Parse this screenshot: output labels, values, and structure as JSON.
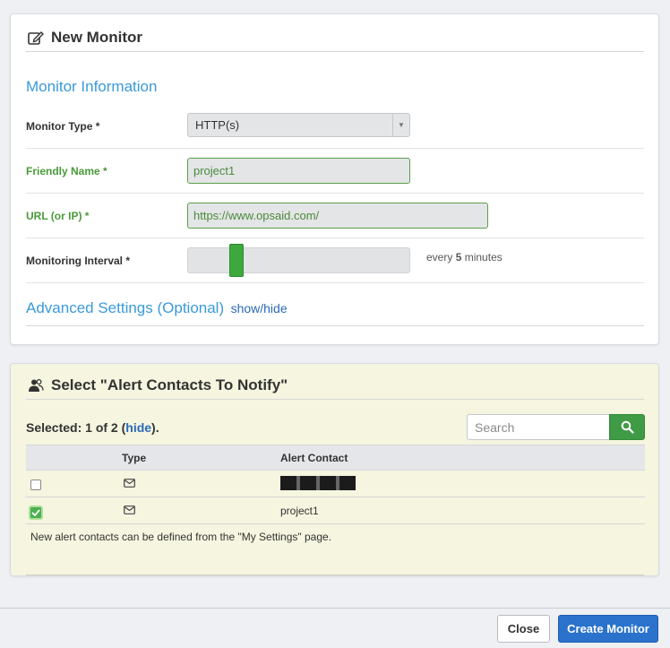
{
  "monitor_panel": {
    "title": "New Monitor",
    "section_title": "Monitor Information",
    "monitor_type": {
      "label": "Monitor Type *",
      "value": "HTTP(s)"
    },
    "friendly_name": {
      "label": "Friendly Name *",
      "value": "project1"
    },
    "url": {
      "label": "URL (or IP) *",
      "value": "https://www.opsaid.com/"
    },
    "interval": {
      "label": "Monitoring Interval *",
      "prefix": "every",
      "value": "5",
      "suffix": "minutes",
      "slider_fraction": 0.2
    },
    "advanced": {
      "title": "Advanced Settings (Optional)",
      "toggle_link": "show/hide"
    }
  },
  "alerts_panel": {
    "title": "Select \"Alert Contacts To Notify\"",
    "selected": {
      "prefix": "Selected: 1 of 2 (",
      "link": "hide",
      "suffix": ")."
    },
    "search": {
      "placeholder": "Search"
    },
    "columns": [
      "Type",
      "Alert Contact"
    ],
    "rows": [
      {
        "checked": false,
        "type_icon": "envelope-icon",
        "contact": "",
        "redacted": true
      },
      {
        "checked": true,
        "type_icon": "envelope-icon",
        "contact": "project1",
        "redacted": false
      }
    ],
    "note": "New alert contacts can be defined from the \"My Settings\" page."
  },
  "footer": {
    "close_label": "Close",
    "create_label": "Create Monitor"
  },
  "colors": {
    "accent_blue": "#3a9ad9",
    "link_blue": "#2a6ab9",
    "success_green": "#3f9b45",
    "primary_button": "#2a72cc",
    "alerts_bg": "#f5f5e0"
  }
}
